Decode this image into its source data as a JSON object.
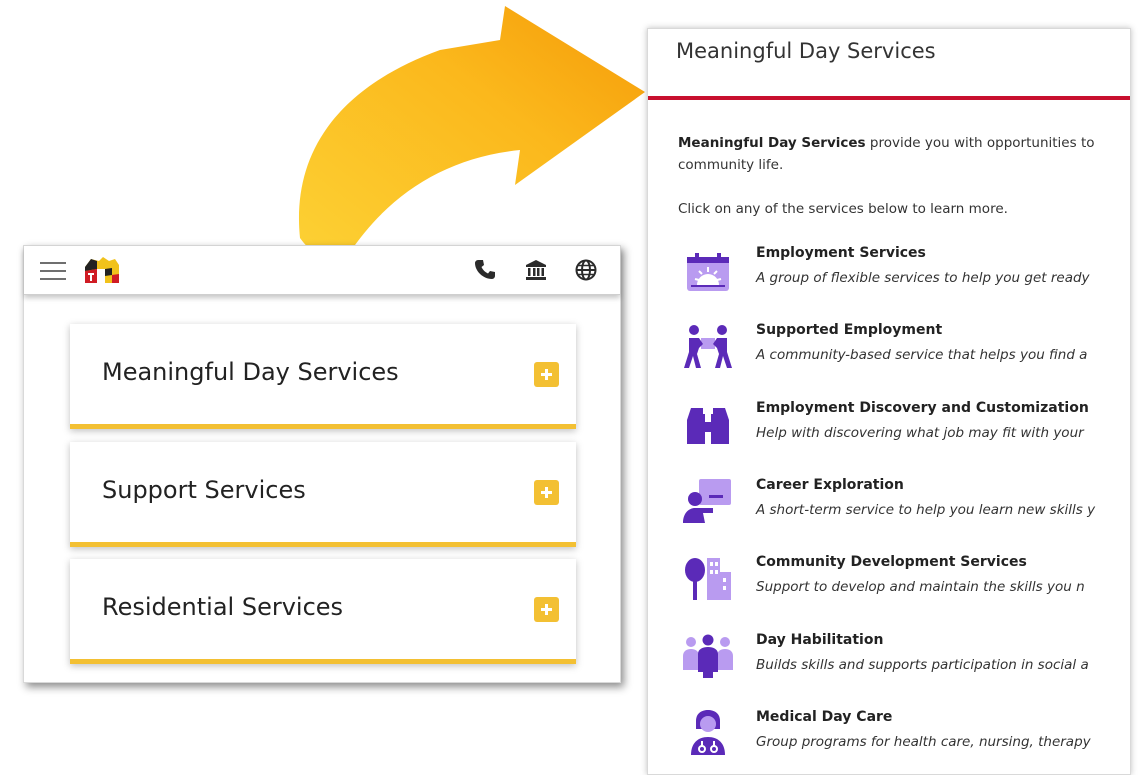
{
  "colors": {
    "accent_yellow": "#f3c033",
    "arrow_orange": "#f9a30a",
    "divider_red": "#c8102e",
    "icon_purple": "#5b2ab8",
    "icon_light_purple": "#b99bf0"
  },
  "mobile": {
    "header": {
      "menu_icon": "hamburger-icon",
      "logo": "maryland-flag-logo",
      "icons": [
        "phone-icon",
        "bank-icon",
        "globe-icon"
      ]
    },
    "accordion": [
      {
        "label": "Meaningful Day Services",
        "icon": "plus-icon"
      },
      {
        "label": "Support Services",
        "icon": "plus-icon"
      },
      {
        "label": "Residential Services",
        "icon": "plus-icon"
      }
    ]
  },
  "detail": {
    "title": "Meaningful Day Services",
    "intro_bold": "Meaningful Day Services",
    "intro_rest": " provide you with opportunities to",
    "intro_line2": "community life.",
    "click_prompt": "Click on any of the services below to learn more.",
    "services": [
      {
        "name": "Employment Services",
        "description": "A group of flexible services to help you get ready",
        "icon": "calendar-sunrise-icon"
      },
      {
        "name": "Supported Employment",
        "description": "A community-based service that helps you find a",
        "icon": "people-carrying-box-icon"
      },
      {
        "name": "Employment Discovery and Customization",
        "description": "Help with discovering what job may fit with your",
        "icon": "binoculars-icon"
      },
      {
        "name": "Career Exploration",
        "description": "A short-term service to help you learn new skills y",
        "icon": "presenter-board-icon"
      },
      {
        "name": "Community Development Services",
        "description": "Support to develop and maintain the skills you n",
        "icon": "tree-building-icon"
      },
      {
        "name": "Day Habilitation",
        "description": "Builds skills and supports participation in social a",
        "icon": "group-people-icon"
      },
      {
        "name": "Medical Day Care",
        "description": "Group programs for health care, nursing, therapy",
        "icon": "nurse-icon"
      }
    ]
  }
}
